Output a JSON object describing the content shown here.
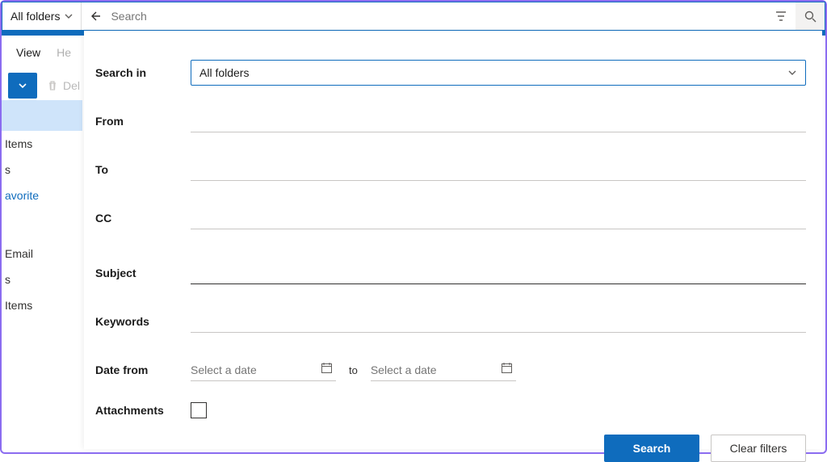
{
  "searchbar": {
    "folder_scope": "All folders",
    "placeholder": "Search"
  },
  "subbar": {
    "view": "View",
    "help_partial": "He",
    "delete_partial": "Del"
  },
  "sidebar": {
    "items": [
      {
        "label": ""
      },
      {
        "label": "Items"
      },
      {
        "label": "s"
      },
      {
        "label": "avorite"
      },
      {
        "label": ""
      },
      {
        "label": "Email"
      },
      {
        "label": "s"
      },
      {
        "label": "Items"
      }
    ]
  },
  "panel": {
    "search_in_label": "Search in",
    "search_in_value": "All folders",
    "from_label": "From",
    "to_label": "To",
    "cc_label": "CC",
    "subject_label": "Subject",
    "keywords_label": "Keywords",
    "date_from_label": "Date from",
    "date_placeholder": "Select a date",
    "date_range_to": "to",
    "attachments_label": "Attachments",
    "search_btn": "Search",
    "clear_btn": "Clear filters"
  }
}
